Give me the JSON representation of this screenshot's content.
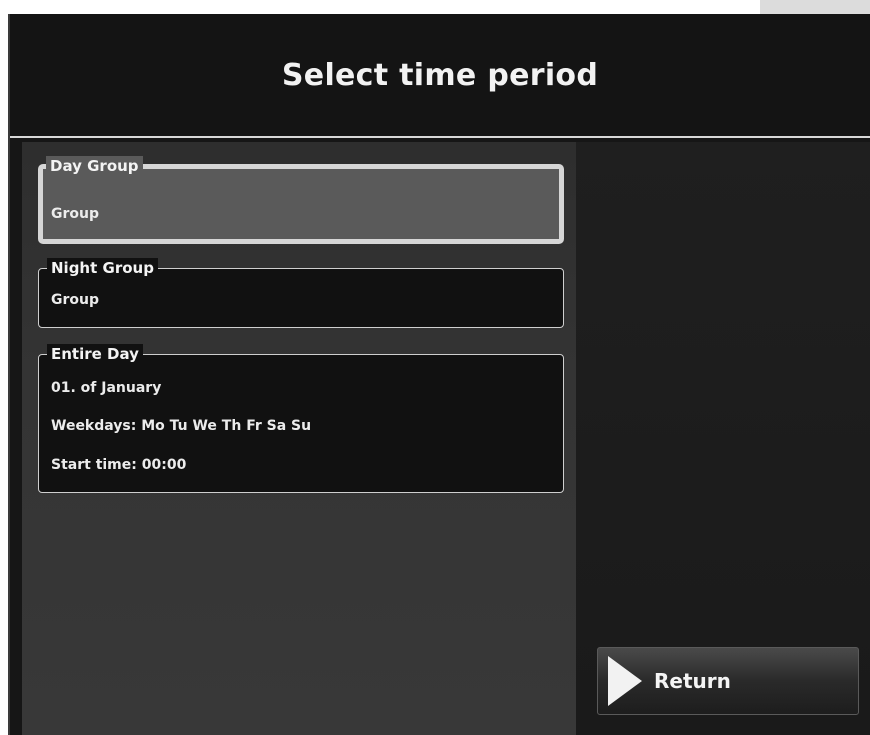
{
  "header": {
    "title": "Select time period"
  },
  "time_periods": [
    {
      "name": "Day Group",
      "lines": [
        "Group"
      ],
      "selected": true
    },
    {
      "name": "Night Group",
      "lines": [
        "Group"
      ],
      "selected": false
    },
    {
      "name": "Entire Day",
      "lines": [
        "01. of January",
        "Weekdays: Mo Tu We Th Fr Sa Su",
        "Start time: 00:00"
      ],
      "selected": false
    }
  ],
  "footer": {
    "return_label": "Return",
    "return_icon": "play-arrow-icon"
  },
  "colors": {
    "background": "#161616",
    "panel": "#333333",
    "selected": "#5a5a5a",
    "text": "#f0f0f0"
  }
}
